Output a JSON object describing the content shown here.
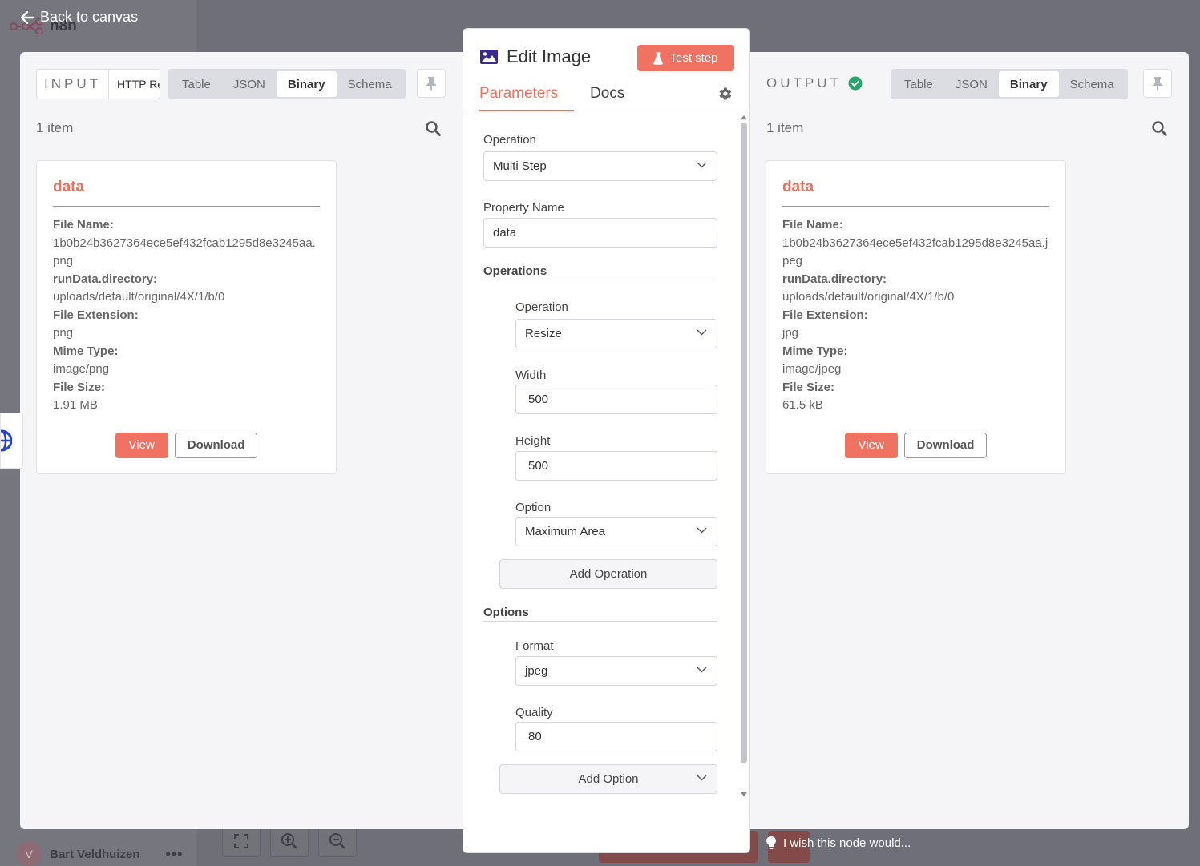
{
  "app": {
    "logo_text": "n8n",
    "back_label": "Back to canvas",
    "user_initial": "V",
    "user_name": "Bart Veldhuizen",
    "wish_text": "I wish this node would..."
  },
  "input": {
    "label": "INPUT",
    "source_node": "HTTP Request",
    "tabs": [
      "Table",
      "JSON",
      "Binary",
      "Schema"
    ],
    "active_tab": "Binary",
    "items_count": "1 item",
    "card": {
      "title": "data",
      "fields": [
        {
          "label": "File Name:",
          "value": "1b0b24b3627364ece5ef432fcab1295d8e3245aa.png"
        },
        {
          "label": "runData.directory:",
          "value": "uploads/default/original/4X/1/b/0"
        },
        {
          "label": "File Extension:",
          "value": "png"
        },
        {
          "label": "Mime Type:",
          "value": "image/png"
        },
        {
          "label": "File Size:",
          "value": "1.91 MB"
        }
      ],
      "view_label": "View",
      "download_label": "Download"
    }
  },
  "output": {
    "label": "OUTPUT",
    "tabs": [
      "Table",
      "JSON",
      "Binary",
      "Schema"
    ],
    "active_tab": "Binary",
    "items_count": "1 item",
    "card": {
      "title": "data",
      "fields": [
        {
          "label": "File Name:",
          "value": "1b0b24b3627364ece5ef432fcab1295d8e3245aa.jpeg"
        },
        {
          "label": "runData.directory:",
          "value": "uploads/default/original/4X/1/b/0"
        },
        {
          "label": "File Extension:",
          "value": "jpg"
        },
        {
          "label": "Mime Type:",
          "value": "image/jpeg"
        },
        {
          "label": "File Size:",
          "value": "61.5 kB"
        }
      ],
      "view_label": "View",
      "download_label": "Download"
    }
  },
  "editor": {
    "title": "Edit Image",
    "test_label": "Test step",
    "tabs": {
      "parameters": "Parameters",
      "docs": "Docs"
    },
    "operation_label": "Operation",
    "operation_value": "Multi Step",
    "property_label": "Property Name",
    "property_value": "data",
    "operations_header": "Operations",
    "sub_operation_label": "Operation",
    "sub_operation_value": "Resize",
    "width_label": "Width",
    "width_value": "500",
    "height_label": "Height",
    "height_value": "500",
    "option_label": "Option",
    "option_value": "Maximum Area",
    "add_operation_label": "Add Operation",
    "options_header": "Options",
    "format_label": "Format",
    "format_value": "jpeg",
    "quality_label": "Quality",
    "quality_value": "80",
    "add_option_label": "Add Option"
  },
  "colors": {
    "accent": "#ef7262",
    "success": "#29a568"
  }
}
